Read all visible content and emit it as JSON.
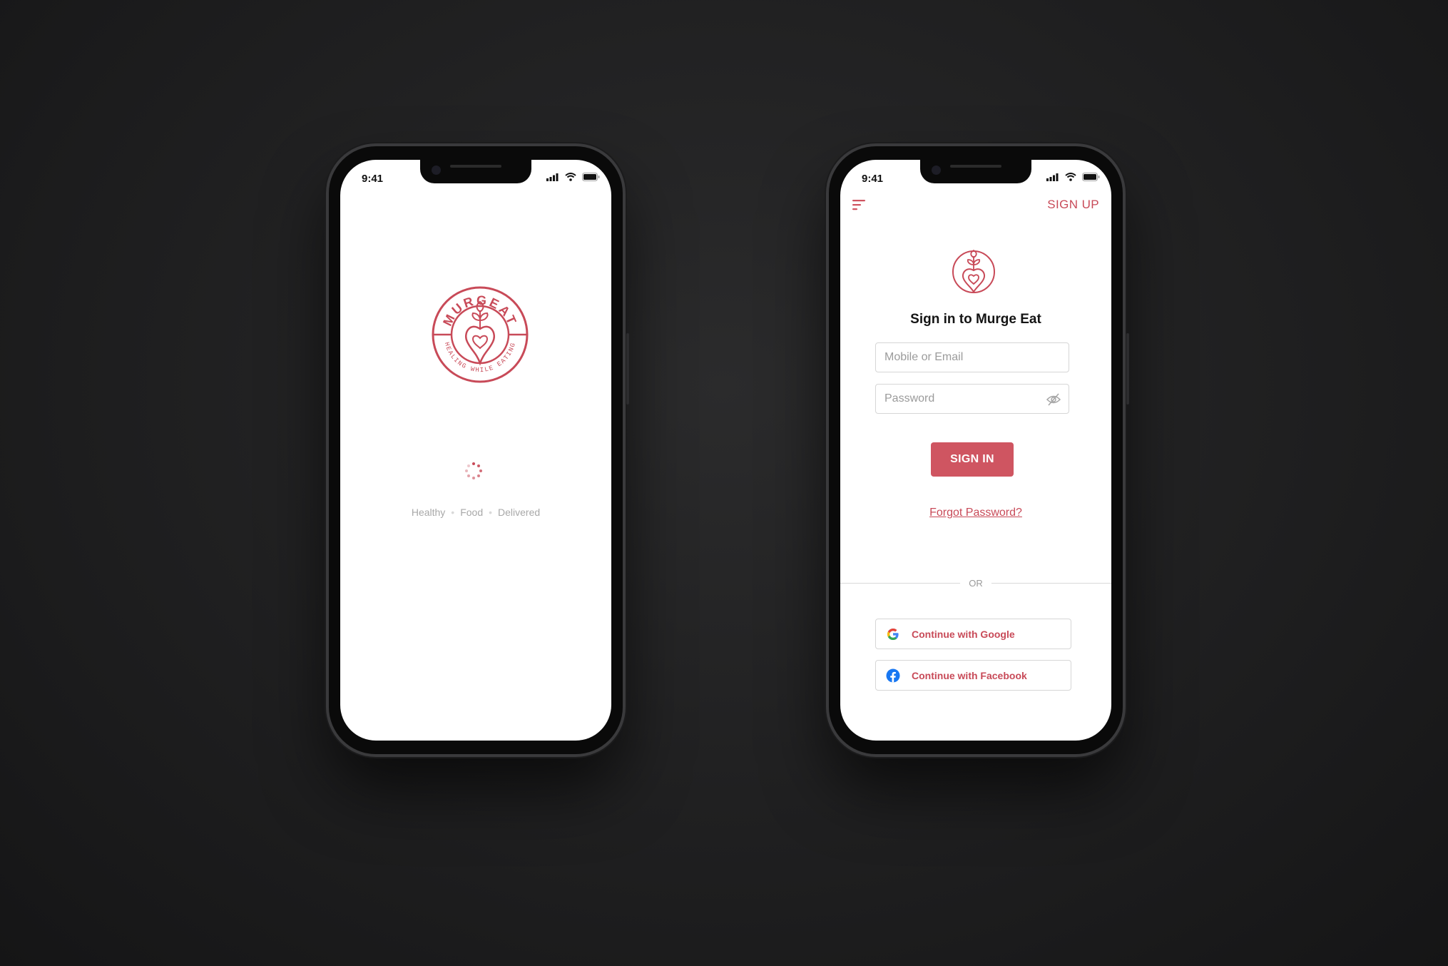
{
  "splash": {
    "status_time": "9:41",
    "tagline": [
      "Healthy",
      "Food",
      "Delivered"
    ],
    "logo_text_top": "MURGEAT",
    "logo_text_bottom": "HEALING WHILE EATING"
  },
  "signin": {
    "status_time": "9:41",
    "signup_label": "SIGN UP",
    "title": "Sign in to Murge Eat",
    "email_placeholder": "Mobile or Email",
    "password_placeholder": "Password",
    "signin_button": "SIGN IN",
    "forgot_password": "Forgot Password?",
    "or_label": "OR",
    "google_label": "Continue with Google",
    "facebook_label": "Continue with Facebook"
  },
  "colors": {
    "brand": "#cf5561",
    "brand_text": "#c84a58",
    "background": "#1f1f20"
  },
  "icons": [
    "menu-icon",
    "eye-off-icon",
    "google-icon",
    "facebook-icon",
    "signal-icon",
    "wifi-icon",
    "battery-icon",
    "loading-spinner-icon",
    "beet-heart-logo"
  ]
}
